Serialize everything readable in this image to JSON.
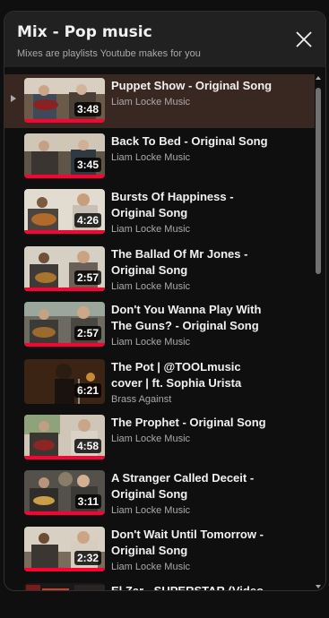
{
  "header": {
    "title": "Mix - Pop music",
    "subtitle": "Mixes are playlists Youtube makes for you"
  },
  "videos": [
    {
      "title": "Puppet Show - Original Song",
      "channel": "Liam Locke Music",
      "duration": "3:48",
      "active": true
    },
    {
      "title": "Back To Bed - Original Song",
      "channel": "Liam Locke Music",
      "duration": "3:45"
    },
    {
      "title": "Bursts Of Happiness - Original Song",
      "channel": "Liam Locke Music",
      "duration": "4:26"
    },
    {
      "title": "The Ballad Of Mr Jones - Original Song",
      "channel": "Liam Locke Music",
      "duration": "2:57"
    },
    {
      "title": "Don't You Wanna Play With The Guns? - Original Song",
      "channel": "Liam Locke Music",
      "duration": "2:57"
    },
    {
      "title": "The Pot | @TOOLmusic cover | ft. Sophia Urista",
      "channel": "Brass Against",
      "duration": "6:21"
    },
    {
      "title": "The Prophet - Original Song",
      "channel": "Liam Locke Music",
      "duration": "4:58"
    },
    {
      "title": "A Stranger Called Deceit - Original Song",
      "channel": "Liam Locke Music",
      "duration": "3:11"
    },
    {
      "title": "Don't Wait Until Tomorrow - Original Song",
      "channel": "Liam Locke Music",
      "duration": "2:32"
    },
    {
      "title": "El Zar - SUPERSTAR (Video Oficial)",
      "channel": "",
      "duration": ""
    }
  ],
  "colors": {
    "panel_bg": "#0f0f0f",
    "header_bg": "#212121",
    "active_row_bg": "#392721",
    "progress_red": "#ff0033"
  },
  "icons": {
    "close": "close-icon",
    "now_playing": "play-indicator-icon",
    "scroll_up": "scroll-up-arrow-icon",
    "scroll_down": "scroll-down-arrow-icon"
  }
}
